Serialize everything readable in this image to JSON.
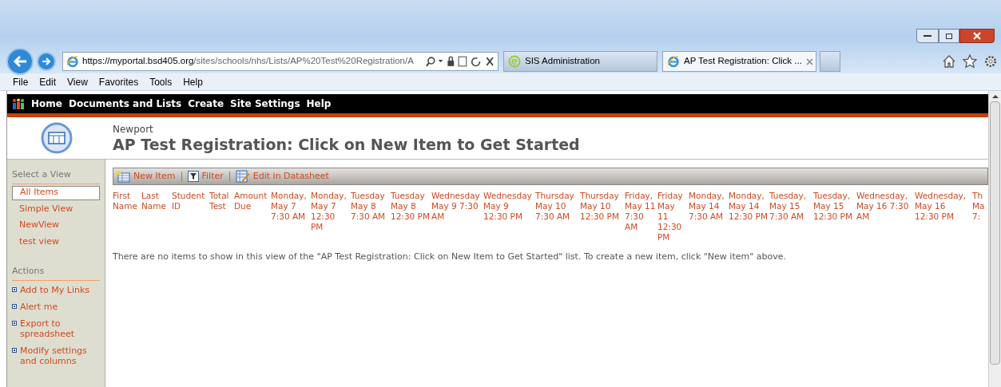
{
  "browser": {
    "address_host": "https://myportal.bsd405.org",
    "address_path": "/sites/schools/nhs/Lists/AP%20Test%20Registration/A",
    "tabs": [
      {
        "label": "SIS Administration",
        "selected": false,
        "kind": "sis"
      },
      {
        "label": "AP Test Registration: Click ...",
        "selected": true,
        "kind": "ie"
      }
    ],
    "menu": [
      "File",
      "Edit",
      "View",
      "Favorites",
      "Tools",
      "Help"
    ]
  },
  "top_nav": [
    "Home",
    "Documents and Lists",
    "Create",
    "Site Settings",
    "Help"
  ],
  "site": {
    "name": "Newport",
    "title": "AP Test Registration: Click on New Item to Get Started"
  },
  "sidebar": {
    "views_heading": "Select a View",
    "views": [
      {
        "label": "All Items",
        "selected": true
      },
      {
        "label": "Simple View",
        "selected": false
      },
      {
        "label": "NewView",
        "selected": false
      },
      {
        "label": "test view",
        "selected": false
      }
    ],
    "actions_heading": "Actions",
    "actions": [
      "Add to My Links",
      "Alert me",
      "Export to spreadsheet",
      "Modify settings and columns"
    ]
  },
  "toolbar": [
    {
      "label": "New Item",
      "kind": "new"
    },
    {
      "label": "Filter",
      "kind": "filter"
    },
    {
      "label": "Edit in Datasheet",
      "kind": "datasheet"
    }
  ],
  "table": {
    "columns": [
      "First Name",
      "Last Name",
      "Student ID",
      "Total Test",
      "Amount Due",
      "Monday, May 7 7:30 AM",
      "Monday, May 7 12:30 PM",
      "Tuesday May 8 7:30 AM",
      "Tuesday May 8 12:30 PM",
      "Wednesday May 9 7:30 AM",
      "Wednesday May 9 12:30 PM",
      "Thursday May 10 7:30 AM",
      "Thursday May 10 12:30 PM",
      "Friday, May 11 7:30 AM",
      "Friday May 11 12:30 PM",
      "Monday, May 14 7:30 AM",
      "Monday, May 14 12:30 PM",
      "Tuesday, May 15 7:30 AM",
      "Tuesday, May 15 12:30 PM",
      "Wednesday, May 16 7:30 AM",
      "Wednesday, May 16 12:30 PM",
      "Th Ma 7:"
    ],
    "empty_message": "There are no items to show in this view of the \"AP Test Registration: Click on New Item to Get Started\" list. To create a new item, click \"New item\" above."
  }
}
